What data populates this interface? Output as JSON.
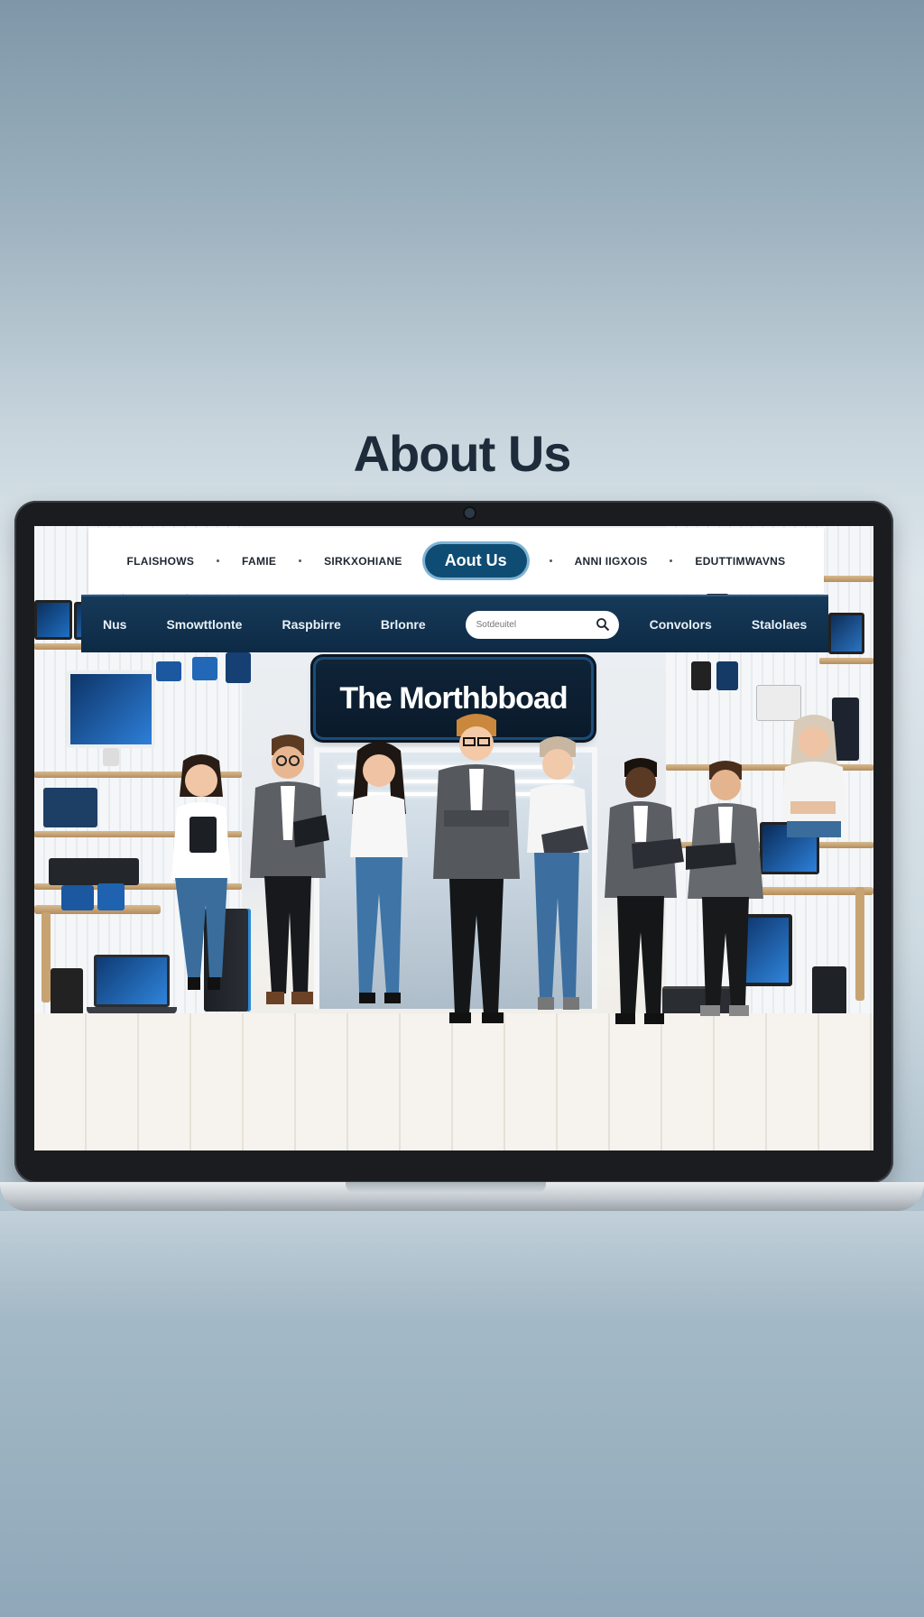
{
  "heading": "About Us",
  "top_nav": {
    "items": [
      "FLAISHOWS",
      "FAMIE",
      "SIRKXOHIANE"
    ],
    "active": "Aout Us",
    "items_right": [
      "ANNI IIGXOIS",
      "EDUTTIMWAVNS"
    ]
  },
  "category_bar": {
    "items_left": [
      "Nus",
      "Smowttlonte",
      "Raspbirre",
      "Brlonre"
    ],
    "search": {
      "placeholder": "Sotdeuitel"
    },
    "items_right": [
      "Convolors",
      "Stalolaes"
    ]
  },
  "store_sign": "The Morthbboad",
  "colors": {
    "nav_active": "#0f4c73",
    "category_bar": "#12324f",
    "sign": "#0f2438"
  }
}
